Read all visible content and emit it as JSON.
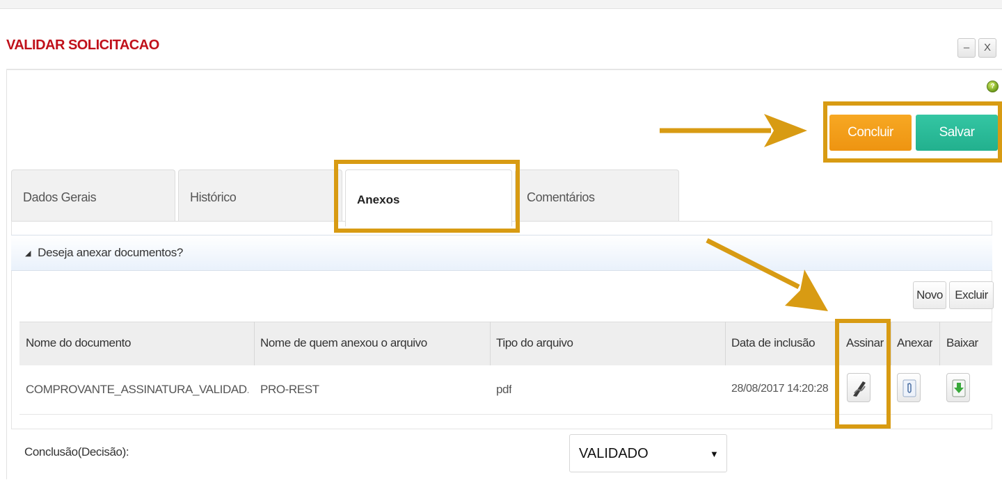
{
  "window": {
    "title": "VALIDAR SOLICITACAO",
    "minimize_label": "–",
    "close_label": "X",
    "help_label": "?"
  },
  "actions": {
    "concluir": "Concluir",
    "salvar": "Salvar"
  },
  "tabs": [
    {
      "label": "Dados Gerais",
      "active": false
    },
    {
      "label": "Histórico",
      "active": false
    },
    {
      "label": "Anexos",
      "active": true
    },
    {
      "label": "Comentários",
      "active": false
    }
  ],
  "section": {
    "title": "Deseja anexar documentos?"
  },
  "toolbar": {
    "novo": "Novo",
    "excluir": "Excluir"
  },
  "table": {
    "columns": [
      "Nome do documento",
      "Nome de quem anexou o arquivo",
      "Tipo do arquivo",
      "Data de inclusão",
      "Assinar",
      "Anexar",
      "Baixar"
    ],
    "rows": [
      {
        "nome": "COMPROVANTE_ASSINATURA_VALIDAD...",
        "anexado_por": "PRO-REST",
        "tipo": "pdf",
        "data": "28/08/2017 14:20:28",
        "assinar_icon": "signature-pen-icon",
        "anexar_icon": "paperclip-icon",
        "baixar_icon": "download-arrow-icon"
      }
    ]
  },
  "conclusao": {
    "label": "Conclusão(Decisão):",
    "selected": "VALIDADO"
  },
  "colors": {
    "title_red": "#c0101a",
    "concluir_orange": "#f09a14",
    "salvar_green": "#27b693",
    "highlight_gold": "#d89b13"
  }
}
